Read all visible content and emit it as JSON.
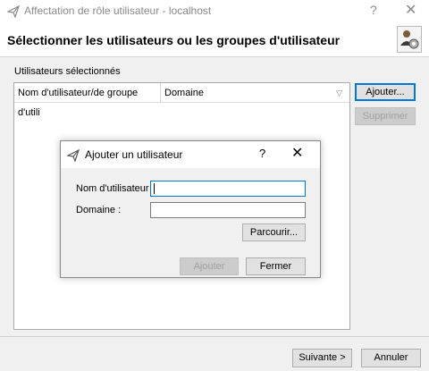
{
  "window": {
    "title": "Affectation de rôle utilisateur - localhost",
    "help": "?",
    "close": "✕",
    "header_title": "Sélectionner les utilisateurs ou les groupes d'utilisateur"
  },
  "main": {
    "group_label": "Utilisateurs sélectionnés",
    "columns": [
      "Nom d'utilisateur/de groupe d'utili",
      "Domaine"
    ],
    "add_button": "Ajouter...",
    "remove_button": "Supprimer"
  },
  "footer": {
    "next_button": "Suivante >",
    "cancel_button": "Annuler"
  },
  "dialog": {
    "title": "Ajouter un utilisateur",
    "help": "?",
    "close": "✕",
    "username_label": "Nom d'utilisateur :",
    "username_value": "",
    "domain_label": "Domaine :",
    "domain_value": "",
    "browse_button": "Parcourir...",
    "add_button": "Ajouter",
    "close_button": "Fermer"
  },
  "colors": {
    "accent": "#0078d7",
    "disabled_text": "#a0a0a0",
    "panel_bg": "#f0f0f0"
  },
  "icons": [
    "send-arrow-icon",
    "users-gear-icon",
    "help-icon",
    "close-icon",
    "sort-icon"
  ]
}
